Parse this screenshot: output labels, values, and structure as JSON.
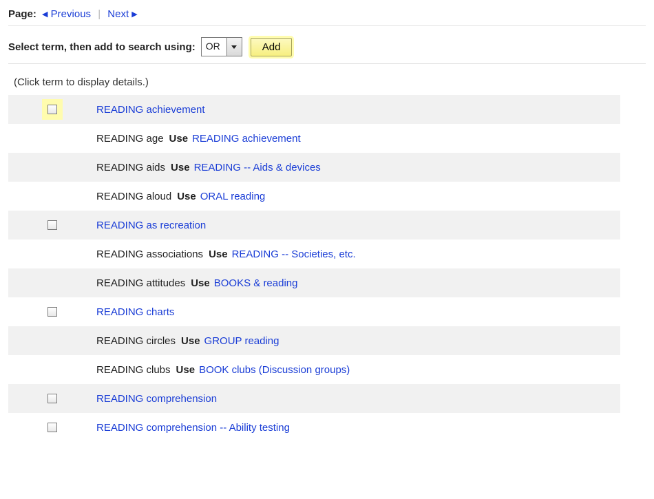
{
  "pager": {
    "page_label": "Page:",
    "prev": "Previous",
    "next": "Next"
  },
  "select_row": {
    "label": "Select term, then add to search using:",
    "operator": "OR",
    "add": "Add"
  },
  "hint": "(Click term to display details.)",
  "use_label": "Use",
  "rows": [
    {
      "alt": true,
      "checkable": true,
      "highlight": true,
      "term": "READING achievement",
      "link": true
    },
    {
      "alt": false,
      "checkable": false,
      "term": "READING age",
      "link": false,
      "use": "READING achievement"
    },
    {
      "alt": true,
      "checkable": false,
      "term": "READING aids",
      "link": false,
      "use": "READING -- Aids & devices"
    },
    {
      "alt": false,
      "checkable": false,
      "term": "READING aloud",
      "link": false,
      "use": "ORAL reading"
    },
    {
      "alt": true,
      "checkable": true,
      "term": "READING as recreation",
      "link": true
    },
    {
      "alt": false,
      "checkable": false,
      "term": "READING associations",
      "link": false,
      "use": "READING -- Societies, etc."
    },
    {
      "alt": true,
      "checkable": false,
      "term": "READING attitudes",
      "link": false,
      "use": "BOOKS & reading"
    },
    {
      "alt": false,
      "checkable": true,
      "term": "READING charts",
      "link": true
    },
    {
      "alt": true,
      "checkable": false,
      "term": "READING circles",
      "link": false,
      "use": "GROUP reading"
    },
    {
      "alt": false,
      "checkable": false,
      "term": "READING clubs",
      "link": false,
      "use": "BOOK clubs (Discussion groups)"
    },
    {
      "alt": true,
      "checkable": true,
      "term": "READING comprehension",
      "link": true
    },
    {
      "alt": false,
      "checkable": true,
      "term": "READING comprehension -- Ability testing",
      "link": true
    }
  ]
}
